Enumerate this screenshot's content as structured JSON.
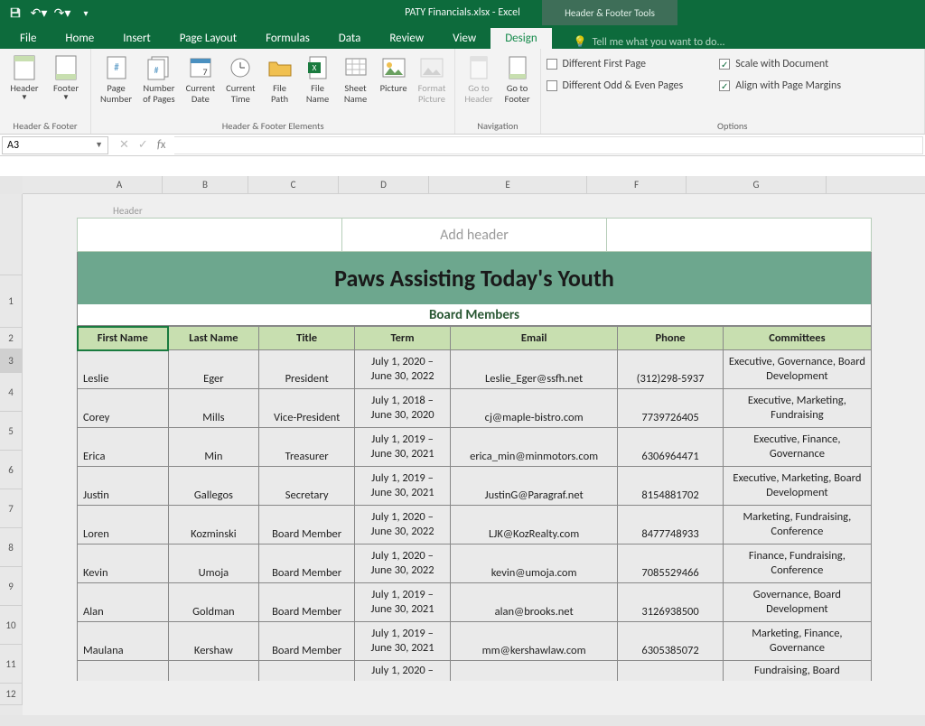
{
  "titlebar": {
    "filename": "PATY Financials.xlsx - Excel",
    "tooltab": "Header & Footer Tools"
  },
  "menu": {
    "tabs": [
      "File",
      "Home",
      "Insert",
      "Page Layout",
      "Formulas",
      "Data",
      "Review",
      "View",
      "Design"
    ],
    "tellme": "Tell me what you want to do..."
  },
  "ribbon": {
    "hf": {
      "label": "Header & Footer",
      "header": "Header",
      "footer": "Footer"
    },
    "elems": {
      "label": "Header & Footer Elements",
      "page_number": "Page\nNumber",
      "pages": "Number\nof Pages",
      "cur_date": "Current\nDate",
      "cur_time": "Current\nTime",
      "file_path": "File\nPath",
      "file_name": "File\nName",
      "sheet": "Sheet\nName",
      "picture": "Picture",
      "fmt_pic": "Format\nPicture"
    },
    "nav": {
      "label": "Navigation",
      "goto_h": "Go to\nHeader",
      "goto_f": "Go to\nFooter"
    },
    "options": {
      "label": "Options",
      "diff_first": "Different First Page",
      "diff_odd": "Different Odd & Even Pages",
      "scale": "Scale with Document",
      "align": "Align with Page Margins",
      "scale_checked": true,
      "align_checked": true
    }
  },
  "namebox": "A3",
  "cols": [
    "A",
    "B",
    "C",
    "D",
    "E",
    "F",
    "G"
  ],
  "rows": [
    "1",
    "2",
    "3",
    "4",
    "5",
    "6",
    "7",
    "8",
    "9",
    "10",
    "11",
    "12"
  ],
  "header_placeholder": "Add header",
  "header_label": "Header",
  "doc": {
    "title": "Paws Assisting Today's Youth",
    "subtitle": "Board Members",
    "headers": [
      "First Name",
      "Last Name",
      "Title",
      "Term",
      "Email",
      "Phone",
      "Committees"
    ],
    "data": [
      [
        "Leslie",
        "Eger",
        "President",
        "July 1, 2020 –\nJune 30, 2022",
        "Leslie_Eger@ssfh.net",
        "(312)298-5937",
        "Executive, Governance, Board Development"
      ],
      [
        "Corey",
        "Mills",
        "Vice-President",
        "July 1, 2018 –\nJune 30, 2020",
        "cj@maple-bistro.com",
        "7739726405",
        "Executive, Marketing, Fundraising"
      ],
      [
        "Erica",
        "Min",
        "Treasurer",
        "July 1, 2019 –\nJune 30, 2021",
        "erica_min@minmotors.com",
        "6306964471",
        "Executive, Finance, Governance"
      ],
      [
        "Justin",
        "Gallegos",
        "Secretary",
        "July 1, 2019 –\nJune 30, 2021",
        "JustinG@Paragraf.net",
        "8154881702",
        "Executive, Marketing, Board Development"
      ],
      [
        "Loren",
        "Kozminski",
        "Board Member",
        "July 1, 2020 –\nJune 30, 2022",
        "LJK@KozRealty.com",
        "8477748933",
        "Marketing, Fundraising, Conference"
      ],
      [
        "Kevin",
        "Umoja",
        "Board Member",
        "July 1, 2020 –\nJune 30, 2022",
        "kevin@umoja.com",
        "7085529466",
        "Finance, Fundraising, Conference"
      ],
      [
        "Alan",
        "Goldman",
        "Board Member",
        "July 1, 2019 –\nJune 30, 2021",
        "alan@brooks.net",
        "3126938500",
        "Governance, Board Development"
      ],
      [
        "Maulana",
        "Kershaw",
        "Board Member",
        "July 1, 2019 –\nJune 30, 2021",
        "mm@kershawlaw.com",
        "6305385072",
        "Marketing, Finance, Governance"
      ],
      [
        "",
        "",
        "",
        "July 1, 2020 –",
        "",
        "",
        "Fundraising, Board"
      ]
    ]
  }
}
